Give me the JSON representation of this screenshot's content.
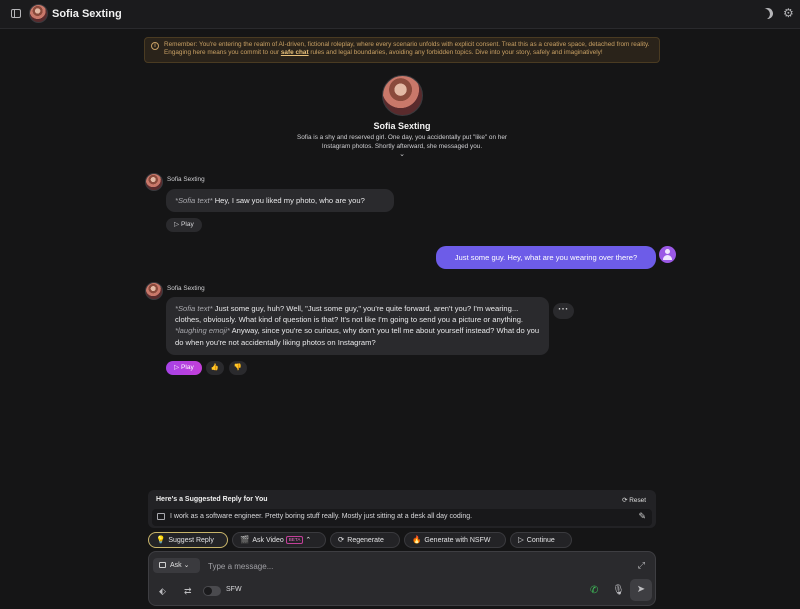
{
  "header": {
    "title": "Sofia Sexting",
    "sidebar_icon": "sidebar-toggle-icon",
    "theme_icon": "moon-icon",
    "settings_icon": "gear-icon"
  },
  "notice": {
    "icon": "info-icon",
    "text_before": "Remember: You're entering the realm of AI-driven, fictional roleplay, where every scenario unfolds with explicit consent. Treat this as a creative space, detached from reality. Engaging here means you commit to our ",
    "link": "safe chat",
    "text_after": " rules and legal boundaries, avoiding any forbidden topics. Dive into your story, safely and imaginatively!"
  },
  "profile": {
    "name": "Sofia Sexting",
    "description": "Sofia is a shy and reserved girl. One day, you accidentally put \"like\" on her Instagram photos. Shortly afterward, she messaged you.",
    "expand_icon": "chevron-down-icon"
  },
  "messages": [
    {
      "sender": "Sofia Sexting",
      "action": "*Sofia text*",
      "text": " Hey, I saw you liked my photo, who are you?",
      "play_label": "Play"
    },
    {
      "sender": "user",
      "text": "Just some guy. Hey, what are you wearing over there?"
    },
    {
      "sender": "Sofia Sexting",
      "action": "*Sofia text*",
      "text1": " Just some guy, huh? Well, \"Just some guy,\" you're quite forward, aren't you? I'm wearing... clothes, obviously. What kind of question is that? It's not like I'm going to send you a picture or anything. ",
      "action2": "*laughing emoji*",
      "text2": " Anyway, since you're so curious, why don't you tell me about yourself instead? What do you do when you're not accidentally liking photos on Instagram?",
      "play_label": "Play"
    }
  ],
  "suggested": {
    "title": "Here's a Suggested Reply for You",
    "reset_label": "Reset",
    "text": "I work as a software engineer. Pretty boring stuff really. Mostly just sitting at a desk all day coding."
  },
  "actions": {
    "suggest_reply": "Suggest Reply",
    "ask_video": "Ask Video",
    "beta": "BETA",
    "regenerate": "Regenerate",
    "generate_nsfw": "Generate with NSFW",
    "continue": "Continue"
  },
  "composer": {
    "mode_label": "Ask",
    "placeholder": "Type a message...",
    "sfw_label": "SFW",
    "sfw_on": false
  },
  "colors": {
    "accent": "#6d5ce8",
    "play": "#b541e0",
    "notice": "#c8a064",
    "call": "#3fbf5a"
  }
}
